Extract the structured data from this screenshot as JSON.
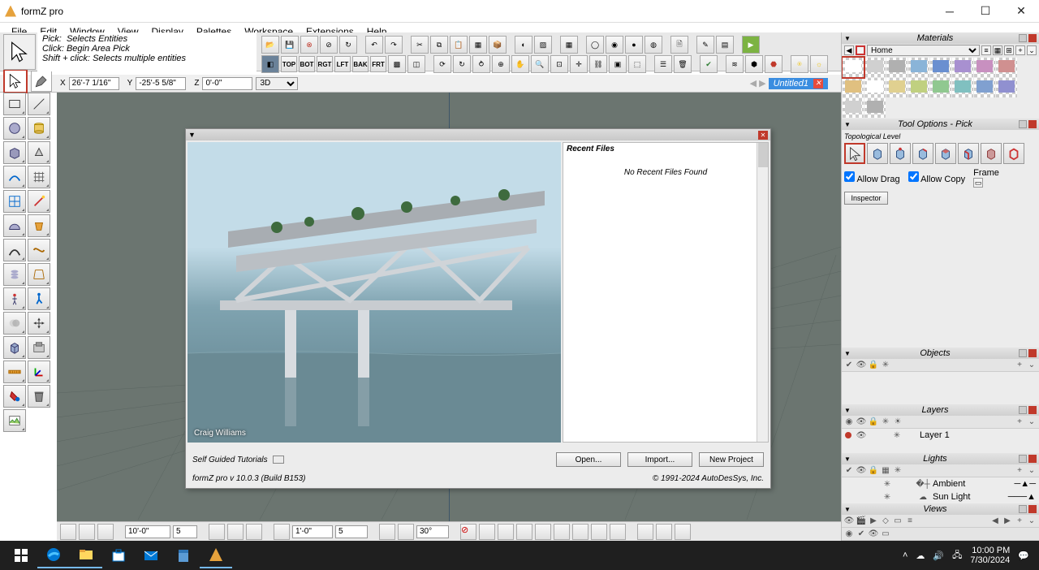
{
  "app_title": "formZ pro",
  "menu": [
    "File",
    "Edit",
    "Window",
    "View",
    "Display",
    "Palettes",
    "Workspace",
    "Extensions",
    "Help"
  ],
  "hints": {
    "l1a": "Pick:",
    "l1b": "Selects Entities",
    "l2a": "Click:",
    "l2b": "Begin Area Pick",
    "l3a": "Shift + click:",
    "l3b": "Selects multiple entities"
  },
  "view_buttons": [
    "TOP",
    "BOT",
    "RGT",
    "LFT",
    "BAK",
    "FRT"
  ],
  "coords": {
    "x_label": "X",
    "x": "26'-7 1/16\"",
    "y_label": "Y",
    "y": "-25'-5 5/8\"",
    "z_label": "Z",
    "z": "0'-0\"",
    "mode": "3D"
  },
  "doc_tab": "Untitled1",
  "dialog": {
    "recent_header": "Recent Files",
    "recent_empty": "No Recent Files Found",
    "tutorials": "Self Guided Tutorials",
    "open": "Open...",
    "import": "Import...",
    "newproj": "New Project",
    "version": "formZ pro v 10.0.3 (Build B153)",
    "copyright": "© 1991-2024 AutoDesSys, Inc.",
    "hero_credit": "Craig Williams"
  },
  "bottom": {
    "v1": "10'-0\"",
    "v2": "5",
    "v3": "1'-0\"",
    "v4": "5",
    "v5": "30°"
  },
  "panels": {
    "materials": "Materials",
    "mat_dropdown": "Home",
    "tool_options": "Tool Options - Pick",
    "topo": "Topological Level",
    "allow_drag": "Allow Drag",
    "allow_copy": "Allow Copy",
    "frame": "Frame",
    "inspector": "Inspector",
    "objects": "Objects",
    "layers": "Layers",
    "layer1": "Layer 1",
    "lights": "Lights",
    "ambient": "Ambient",
    "sunlight": "Sun Light",
    "views": "Views"
  },
  "swatch_colors": [
    "#ffffff",
    "#d0d0d0",
    "#b0b0b0",
    "#8ab4d8",
    "#6a8fd0",
    "#a890d0",
    "#c890c0",
    "#d09090",
    "#e0c080",
    "#ffffff",
    "#e0d090",
    "#c0d080",
    "#90c890",
    "#80c0c0",
    "#80a0d0",
    "#9090d0",
    "#d0d0d0",
    "#b0b0b0"
  ],
  "taskbar": {
    "time": "10:00 PM",
    "date": "7/30/2024"
  }
}
